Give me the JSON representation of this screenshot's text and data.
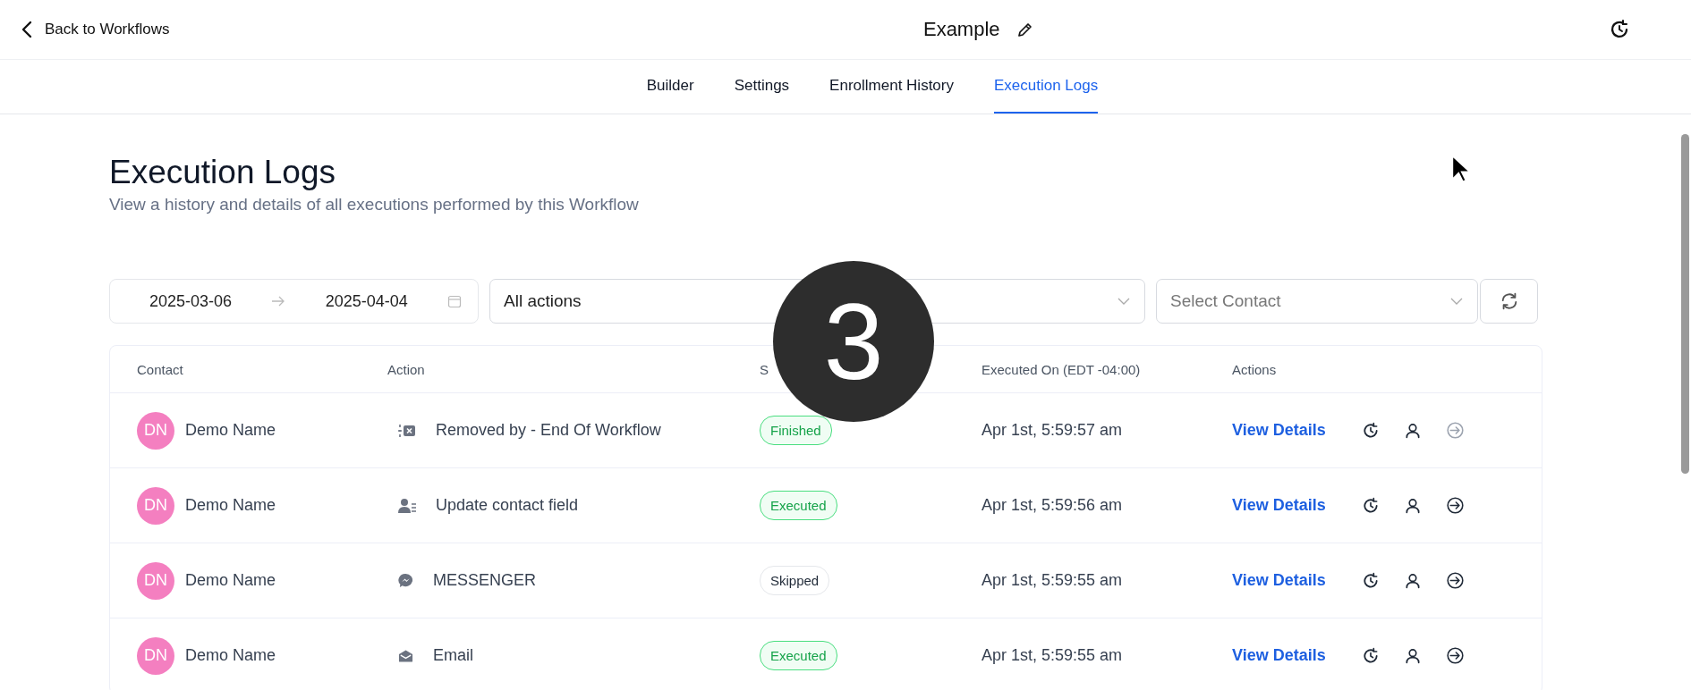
{
  "header": {
    "back_label": "Back to Workflows",
    "title": "Example"
  },
  "tabs": [
    {
      "label": "Builder",
      "selected": false
    },
    {
      "label": "Settings",
      "selected": false
    },
    {
      "label": "Enrollment History",
      "selected": false
    },
    {
      "label": "Execution Logs",
      "selected": true
    }
  ],
  "page": {
    "title": "Execution Logs",
    "subtitle": "View a history and details of all executions performed by this Workflow"
  },
  "filters": {
    "date_from": "2025-03-06",
    "date_to": "2025-04-04",
    "action_filter": "All actions",
    "contact_placeholder": "Select Contact"
  },
  "table": {
    "columns": [
      "Contact",
      "Action",
      "S",
      "Executed On (EDT -04:00)",
      "Actions"
    ],
    "rows": [
      {
        "initials": "DN",
        "contact": "Demo Name",
        "action": {
          "kind": "removed",
          "label": "Removed by - End Of Workflow"
        },
        "status": {
          "kind": "success",
          "label": "Finished"
        },
        "executed_on": "Apr 1st, 5:59:57 am",
        "link": "View Details",
        "enter_disabled": true
      },
      {
        "initials": "DN",
        "contact": "Demo Name",
        "action": {
          "kind": "contact",
          "label": "Update contact field"
        },
        "status": {
          "kind": "success",
          "label": "Executed"
        },
        "executed_on": "Apr 1st, 5:59:56 am",
        "link": "View Details",
        "enter_disabled": false
      },
      {
        "initials": "DN",
        "contact": "Demo Name",
        "action": {
          "kind": "messenger",
          "label": "MESSENGER"
        },
        "status": {
          "kind": "neutral",
          "label": "Skipped"
        },
        "executed_on": "Apr 1st, 5:59:55 am",
        "link": "View Details",
        "enter_disabled": false
      },
      {
        "initials": "DN",
        "contact": "Demo Name",
        "action": {
          "kind": "email",
          "label": "Email"
        },
        "status": {
          "kind": "success",
          "label": "Executed"
        },
        "executed_on": "Apr 1st, 5:59:55 am",
        "link": "View Details",
        "enter_disabled": false
      }
    ]
  },
  "step_marker": {
    "label": "3"
  }
}
